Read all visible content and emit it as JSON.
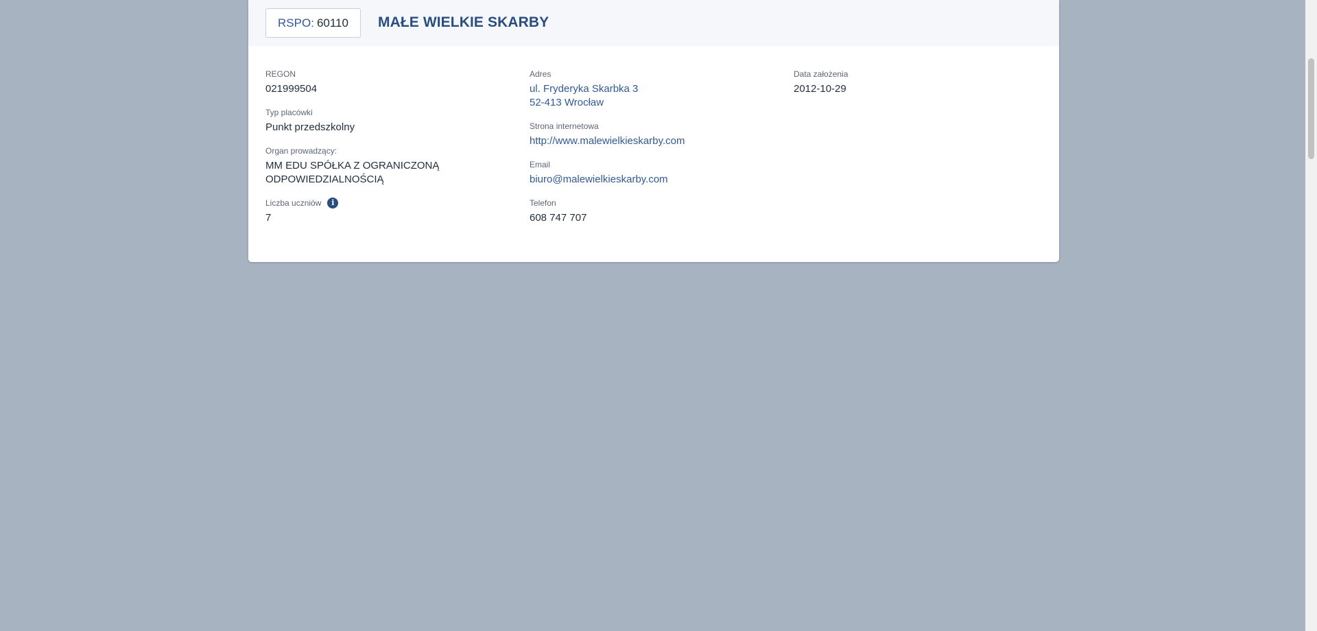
{
  "header": {
    "rspo_label": "RSPO:",
    "rspo_value": "60110",
    "school_name": "MAŁE WIELKIE SKARBY"
  },
  "details": {
    "regon_label": "REGON",
    "regon_value": "021999504",
    "type_label": "Typ placówki",
    "type_value": "Punkt przedszkolny",
    "organ_label": "Organ prowadzący:",
    "organ_value_line1": "MM EDU SPÓŁKA Z OGRANICZONĄ",
    "organ_value_line2": "ODPOWIEDZIALNOŚCIĄ",
    "students_label": "Liczba uczniów",
    "students_value": "7",
    "address_label": "Adres",
    "address_line1": "ul. Fryderyka Skarbka 3",
    "address_line2": "52-413 Wrocław",
    "website_label": "Strona internetowa",
    "website_value": "http://www.malewielkieskarby.com",
    "email_label": "Email",
    "email_value": "biuro@malewielkieskarby.com",
    "phone_label": "Telefon",
    "phone_value": "608 747 707",
    "founded_label": "Data założenia",
    "founded_value": "2012-10-29"
  },
  "icons": {
    "info": "info-icon"
  },
  "colors": {
    "background": "#a8b3c2",
    "accent": "#2a4d80",
    "link": "#2f5a94"
  }
}
